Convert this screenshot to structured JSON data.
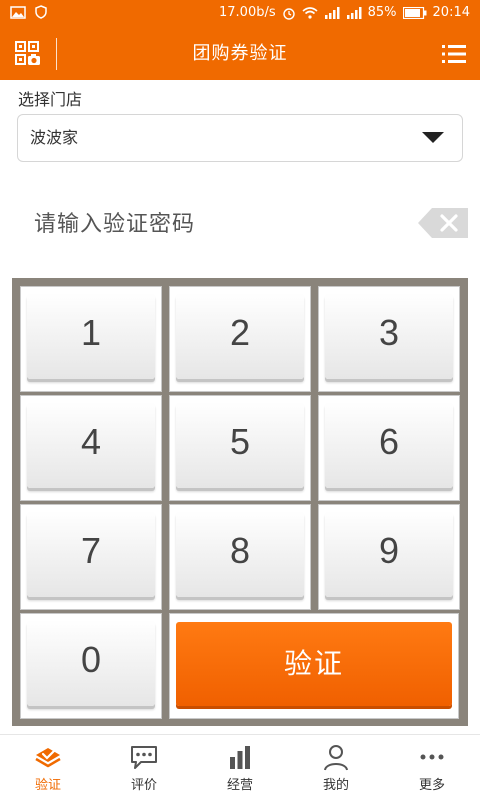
{
  "status_bar": {
    "speed": "17.00b/s",
    "battery": "85%",
    "time": "20:14"
  },
  "header": {
    "title": "团购券验证"
  },
  "store": {
    "label": "选择门店",
    "selected": "波波家"
  },
  "password": {
    "placeholder": "请输入验证密码"
  },
  "keypad": {
    "keys": [
      "1",
      "2",
      "3",
      "4",
      "5",
      "6",
      "7",
      "8",
      "9",
      "0"
    ],
    "verify_label": "验证"
  },
  "bottom_nav": {
    "items": [
      {
        "label": "验证",
        "icon": "verify-icon",
        "active": true
      },
      {
        "label": "评价",
        "icon": "comment-icon",
        "active": false
      },
      {
        "label": "经营",
        "icon": "bar-chart-icon",
        "active": false
      },
      {
        "label": "我的",
        "icon": "user-icon",
        "active": false
      },
      {
        "label": "更多",
        "icon": "more-icon",
        "active": false
      }
    ]
  },
  "colors": {
    "accent": "#f06a00",
    "keypad_bg": "#8a847b"
  }
}
